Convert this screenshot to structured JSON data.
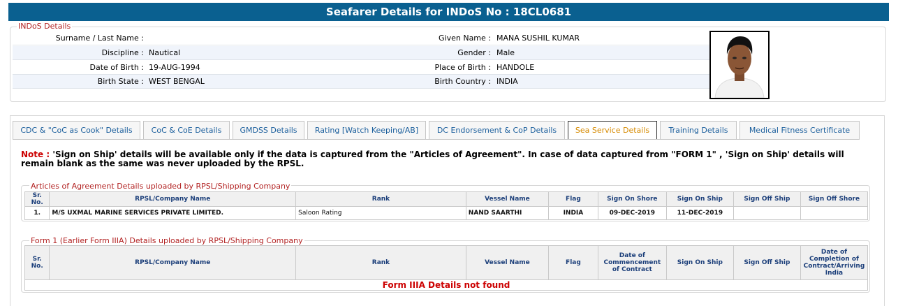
{
  "title": "Seafarer Details for INDoS No : 18CL0681",
  "indos": {
    "legend": "INDoS Details",
    "rows": [
      {
        "l1": "Surname / Last Name :",
        "v1": "",
        "l2": "Given Name :",
        "v2": "MANA SUSHIL KUMAR"
      },
      {
        "l1": "Discipline :",
        "v1": "Nautical",
        "l2": "Gender :",
        "v2": "Male"
      },
      {
        "l1": "Date of Birth :",
        "v1": "19-AUG-1994",
        "l2": "Place of Birth :",
        "v2": "HANDOLE"
      },
      {
        "l1": "Birth State :",
        "v1": "WEST BENGAL",
        "l2": "Birth Country :",
        "v2": "INDIA"
      }
    ]
  },
  "tabs": [
    {
      "label": "CDC & \"CoC as Cook\" Details"
    },
    {
      "label": "CoC & CoE Details"
    },
    {
      "label": "GMDSS Details"
    },
    {
      "label": "Rating [Watch Keeping/AB]"
    },
    {
      "label": "DC Endorsement & CoP Details"
    },
    {
      "label": "Sea Service Details"
    },
    {
      "label": "Training Details"
    },
    {
      "label": "Medical Fitness Certificate"
    }
  ],
  "active_tab": "Sea Service Details",
  "note": {
    "label": "Note :",
    "text": "'Sign on Ship' details will be available only if the data is captured from the \"Articles of Agreement\". In case of data captured from \"FORM 1\" , 'Sign on Ship' details will remain blank as the same was never uploaded by the RPSL."
  },
  "articles": {
    "legend": "Articles of Agreement Details uploaded by RPSL/Shipping Company",
    "headers": [
      "Sr. No.",
      "RPSL/Company Name",
      "Rank",
      "Vessel Name",
      "Flag",
      "Sign On Shore",
      "Sign On Ship",
      "Sign Off Ship",
      "Sign Off Shore"
    ],
    "rows": [
      [
        "1.",
        "M/S UXMAL MARINE SERVICES PRIVATE LIMITED.",
        "Saloon Rating",
        "NAND SAARTHI",
        "INDIA",
        "09-DEC-2019",
        "11-DEC-2019",
        "",
        ""
      ]
    ]
  },
  "form1": {
    "legend": "Form 1 (Earlier Form IIIA) Details uploaded by RPSL/Shipping Company",
    "headers": [
      "Sr. No.",
      "RPSL/Company Name",
      "Rank",
      "Vessel Name",
      "Flag",
      "Date of Commencement of Contract",
      "Sign On Ship",
      "Sign Off Ship",
      "Date of Completion of Contract/Arriving India"
    ],
    "empty_message": "Form IIIA Details not found"
  },
  "colors": {
    "header_bar": "#0a6090",
    "legend": "#b22222",
    "note_label": "#cc0000",
    "tab_text": "#1a5e9c",
    "active_tab_text": "#d68a00"
  }
}
